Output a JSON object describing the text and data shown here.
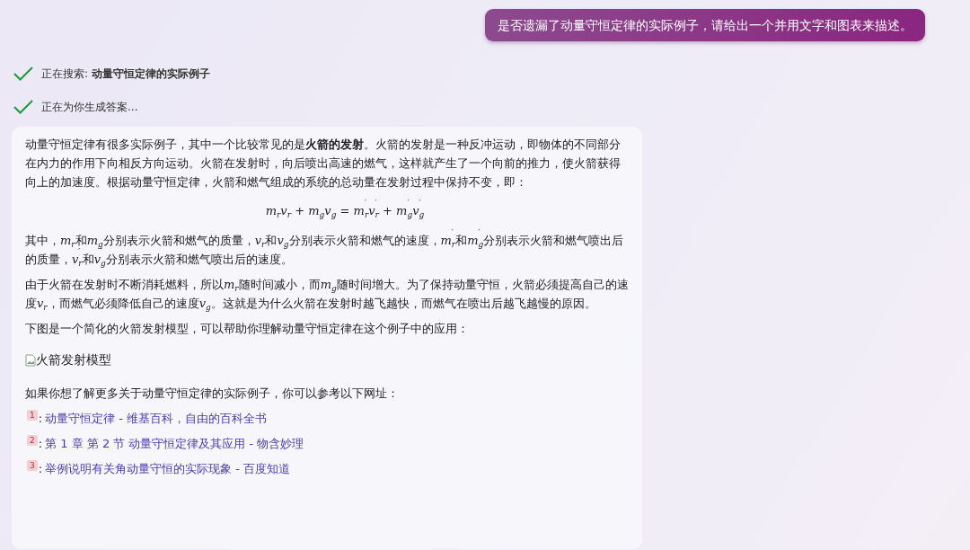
{
  "user_message": "是否遗漏了动量守恒定律的实际例子，请给出一个并用文字和图表来描述。",
  "progress": [
    {
      "text": "正在搜索: **动量守恒定律的实际例子**",
      "done": true
    },
    {
      "text": "正在为你生成答案...",
      "done": true
    }
  ],
  "answer": {
    "blocks": [
      {
        "kind": "paragraph",
        "parts": [
          {
            "kind": "text",
            "text": "动量守恒定律有很多实际例子，其中一个比较常见的是**火箭的发射**。火箭的发射是一种反冲运动，即物体的不同部分在内力的作用下向相反方向运动。火箭在发射时，向后喷出高速的燃气，这样就产生了一个向前的推力，使火箭获得向上的加速度。根据动量守恒定律，火箭和燃气组成的系统的总动量在发射过程中保持不变，即："
          }
        ]
      },
      {
        "kind": "formula",
        "parts": [
          {
            "kind": "math",
            "base": "m",
            "sub": "r"
          },
          {
            "kind": "math",
            "base": "v",
            "sub": "r"
          },
          {
            "kind": "text",
            "text": " + "
          },
          {
            "kind": "math",
            "base": "m",
            "sub": "g"
          },
          {
            "kind": "math",
            "base": "v",
            "sub": "g"
          },
          {
            "kind": "text",
            "text": " = "
          },
          {
            "kind": "math",
            "base": "m",
            "sub": "r",
            "sup": "′"
          },
          {
            "kind": "math",
            "base": "v",
            "sub": "r",
            "sup": "′"
          },
          {
            "kind": "text",
            "text": " + "
          },
          {
            "kind": "math",
            "base": "m",
            "sub": "g",
            "sup": "′"
          },
          {
            "kind": "math",
            "base": "v",
            "sub": "g",
            "sup": "′"
          }
        ]
      },
      {
        "kind": "paragraph",
        "parts": [
          {
            "kind": "text",
            "text": "其中，"
          },
          {
            "kind": "math",
            "base": "m",
            "sub": "r"
          },
          {
            "kind": "text",
            "text": "和"
          },
          {
            "kind": "math",
            "base": "m",
            "sub": "g"
          },
          {
            "kind": "text",
            "text": "分别表示火箭和燃气的质量，"
          },
          {
            "kind": "math",
            "base": "v",
            "sub": "r"
          },
          {
            "kind": "text",
            "text": "和"
          },
          {
            "kind": "math",
            "base": "v",
            "sub": "g"
          },
          {
            "kind": "text",
            "text": "分别表示火箭和燃气的速度，"
          },
          {
            "kind": "math",
            "base": "m",
            "sub": "r",
            "sup": "′"
          },
          {
            "kind": "text",
            "text": "和"
          },
          {
            "kind": "math",
            "base": "m",
            "sub": "g",
            "sup": "′"
          },
          {
            "kind": "text",
            "text": "分别表示火箭和燃气喷出后的质量，"
          },
          {
            "kind": "math",
            "base": "v",
            "sub": "r",
            "sup": "′"
          },
          {
            "kind": "text",
            "text": "和"
          },
          {
            "kind": "math",
            "base": "v",
            "sub": "g",
            "sup": "′"
          },
          {
            "kind": "text",
            "text": "分别表示火箭和燃气喷出后的速度。"
          }
        ]
      },
      {
        "kind": "paragraph",
        "parts": [
          {
            "kind": "text",
            "text": "由于火箭在发射时不断消耗燃料，所以"
          },
          {
            "kind": "math",
            "base": "m",
            "sub": "r"
          },
          {
            "kind": "text",
            "text": "随时间减小，而"
          },
          {
            "kind": "math",
            "base": "m",
            "sub": "g"
          },
          {
            "kind": "text",
            "text": "随时间增大。为了保持动量守恒，火箭必须提高自己的速度"
          },
          {
            "kind": "math",
            "base": "v",
            "sub": "r"
          },
          {
            "kind": "text",
            "text": "，而燃气必须降低自己的速度"
          },
          {
            "kind": "math",
            "base": "v",
            "sub": "g"
          },
          {
            "kind": "text",
            "text": "。这就是为什么火箭在发射时越飞越快，而燃气在喷出后越飞越慢的原因。"
          }
        ]
      },
      {
        "kind": "paragraph",
        "parts": [
          {
            "kind": "text",
            "text": "下图是一个简化的火箭发射模型，可以帮助你理解动量守恒定律在这个例子中的应用："
          }
        ]
      },
      {
        "kind": "image",
        "alt": "火箭发射模型"
      },
      {
        "kind": "paragraph",
        "parts": [
          {
            "kind": "text",
            "text": "如果你想了解更多关于动量守恒定律的实际例子，你可以参考以下网址："
          }
        ]
      }
    ],
    "references": [
      {
        "number": "1",
        "separator": ":",
        "title": "动量守恒定律 - 维基百科，自由的百科全书"
      },
      {
        "number": "2",
        "separator": ":",
        "title": "第 1 章 第 2 节 动量守恒定律及其应用 - 物含妙理"
      },
      {
        "number": "3",
        "separator": ":",
        "title": "举例说明有关角动量守恒的实际现象 - 百度知道"
      }
    ]
  }
}
